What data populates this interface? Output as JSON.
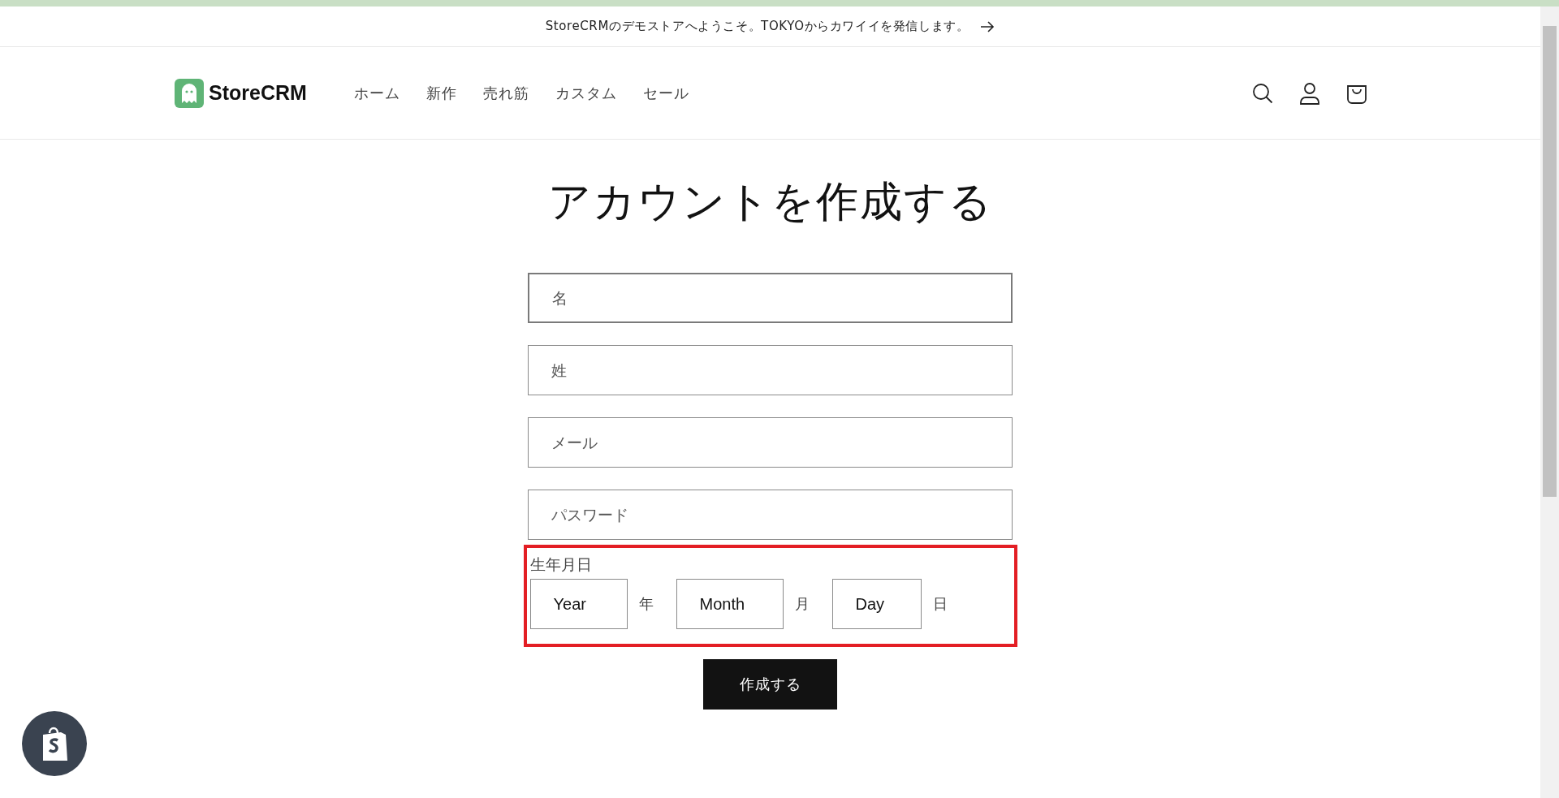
{
  "announcement": {
    "text": "StoreCRMのデモストアへようこそ。TOKYOからカワイイを発信します。"
  },
  "header": {
    "logo": "StoreCRM",
    "nav": [
      {
        "label": "ホーム"
      },
      {
        "label": "新作"
      },
      {
        "label": "売れ筋"
      },
      {
        "label": "カスタム"
      },
      {
        "label": "セール"
      }
    ]
  },
  "title": "アカウントを作成する",
  "fields": [
    {
      "placeholder": "名",
      "focused": true
    },
    {
      "placeholder": "姓",
      "focused": false
    },
    {
      "placeholder": "メール",
      "focused": false
    },
    {
      "placeholder": "パスワード",
      "focused": false
    }
  ],
  "birthday": {
    "label": "生年月日",
    "highlighted": true,
    "parts": [
      {
        "placeholder": "Year",
        "unit": "年"
      },
      {
        "placeholder": "Month",
        "unit": "月"
      },
      {
        "placeholder": "Day",
        "unit": "日"
      }
    ]
  },
  "submit": "作成する"
}
